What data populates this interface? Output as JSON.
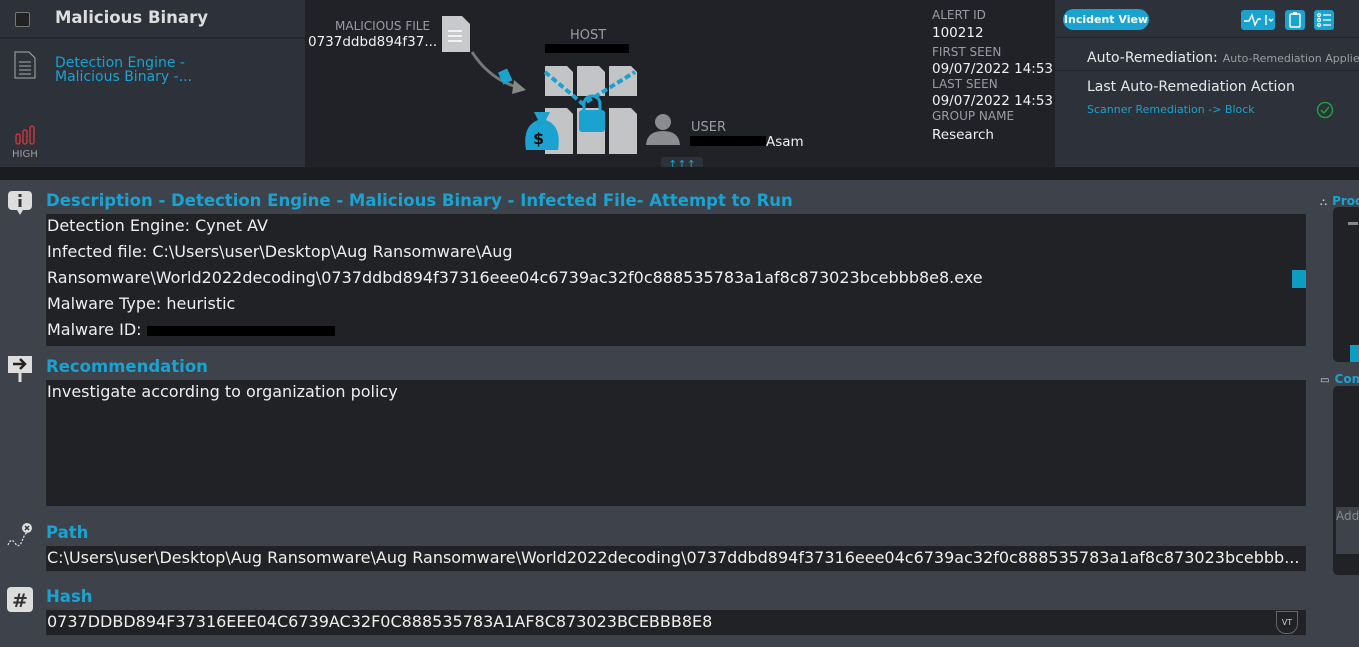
{
  "alert": {
    "title": "Malicious Binary",
    "subtitle": "Detection Engine - Malicious Binary -...",
    "severity": "HIGH",
    "severity_color": "#d0353a"
  },
  "flow": {
    "file_label": "MALICIOUS FILE",
    "file_value": "0737ddbd894f37...",
    "host_label": "HOST",
    "user_label": "USER",
    "user_value": "Asam",
    "expand": "↑↑↑"
  },
  "meta": [
    {
      "label": "ALERT ID",
      "value": "100212"
    },
    {
      "label": "FIRST SEEN",
      "value": "09/07/2022 14:53"
    },
    {
      "label": "LAST SEEN",
      "value": "09/07/2022 14:53"
    },
    {
      "label": "GROUP NAME",
      "value": "Research"
    }
  ],
  "right": {
    "incident_view": "Incident View",
    "auto_label": "Auto-Remediation:",
    "auto_value": "Auto-Remediation Applied",
    "last_action_title": "Last Auto-Remediation Action",
    "last_action": "Scanner Remediation -> Block"
  },
  "sections": {
    "description": {
      "title": "Description - Detection Engine - Malicious Binary - Infected File- Attempt to Run",
      "lines": [
        "Detection Engine: Cynet AV",
        "Infected file: C:\\Users\\user\\Desktop\\Aug Ransomware\\Aug",
        "Ransomware\\World2022decoding\\0737ddbd894f37316eee04c6739ac32f0c888535783a1af8c873023bcebbb8e8.exe",
        "Malware Type: heuristic",
        "Malware ID: "
      ]
    },
    "recommendation": {
      "title": "Recommendation",
      "text": "Investigate according to organization policy"
    },
    "path": {
      "title": "Path",
      "text": "C:\\Users\\user\\Desktop\\Aug Ransomware\\Aug Ransomware\\World2022decoding\\0737ddbd894f37316eee04c6739ac32f0c888535783a1af8c873023bcebbb..."
    },
    "hash": {
      "title": "Hash",
      "text": "0737DDBD894F37316EEE04C6739AC32F0C888535783A1AF8C873023BCEBBB8E8",
      "vt": "VT"
    }
  },
  "side": {
    "process_title": "Proc",
    "comments_title": "Com",
    "comment_placeholder": "Add"
  },
  "colors": {
    "accent": "#1aa3d0",
    "success": "#1e9e3a"
  }
}
